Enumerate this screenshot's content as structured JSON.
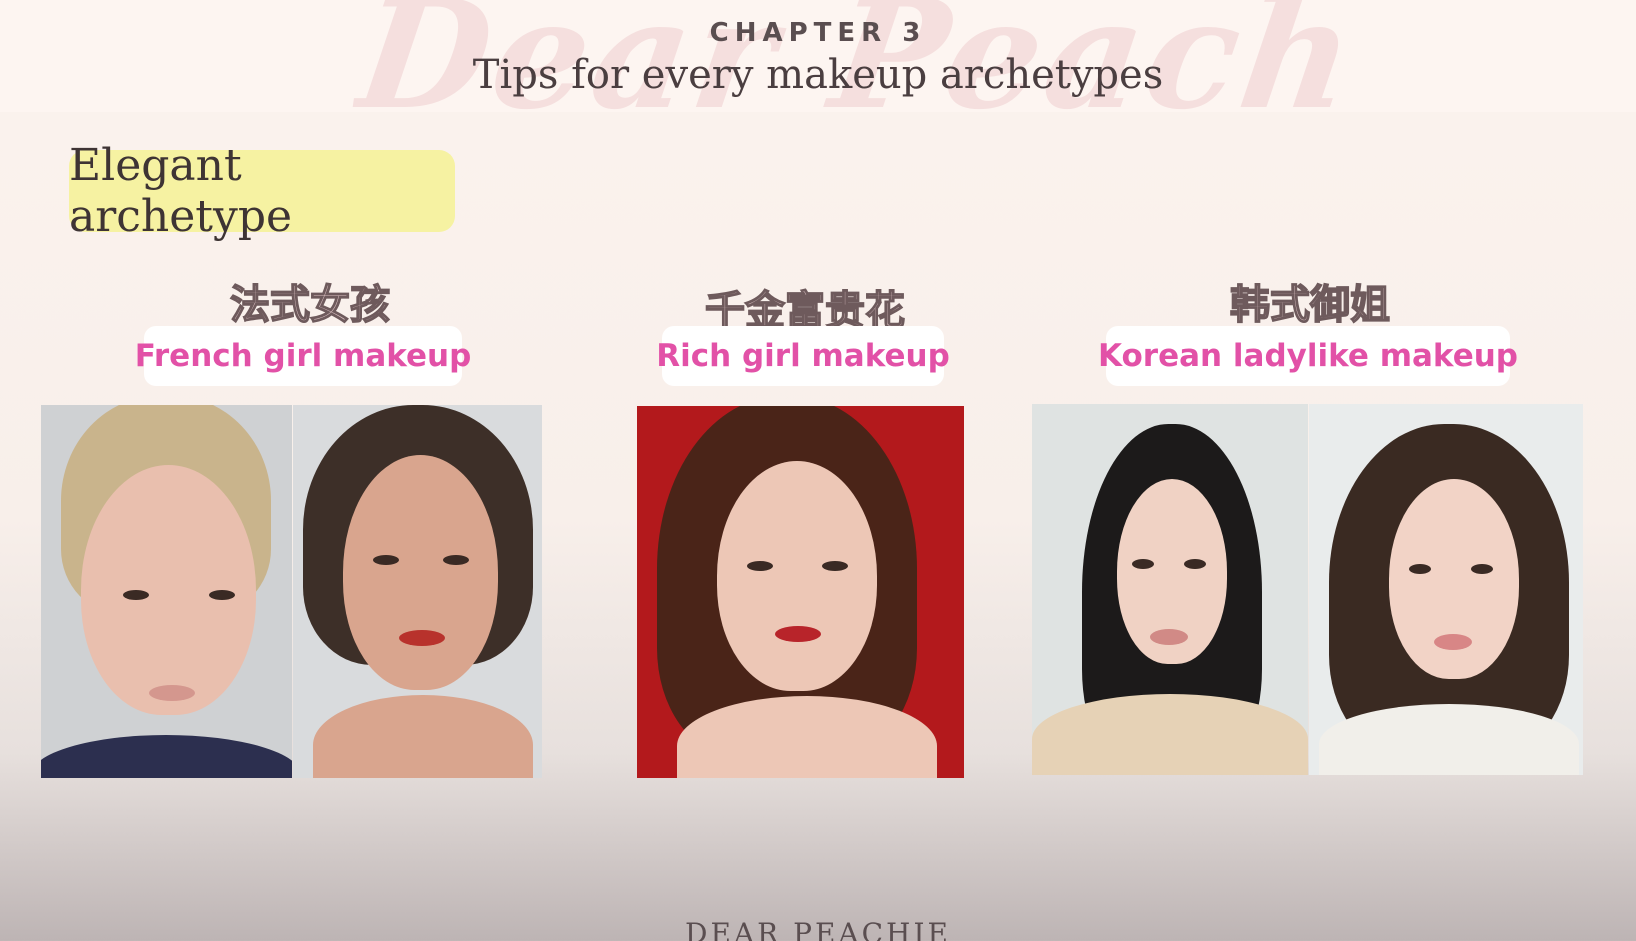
{
  "header": {
    "watermark": "Dear Peachie",
    "chapter": "CHAPTER 3",
    "title": "Tips for every makeup archetypes"
  },
  "archetype": {
    "label": "Elegant archetype"
  },
  "columns": [
    {
      "cn": "法式女孩",
      "en": "French girl makeup"
    },
    {
      "cn": "千金富贵花",
      "en": "Rich girl makeup"
    },
    {
      "cn": "韩式御姐",
      "en": "Korean ladylike makeup"
    }
  ],
  "colors": {
    "badge": "#f6f2a2",
    "pink_label": "#e251a7",
    "red_backdrop": "#b3191c"
  },
  "footer": {
    "brand": "DEAR PEACHIE"
  }
}
